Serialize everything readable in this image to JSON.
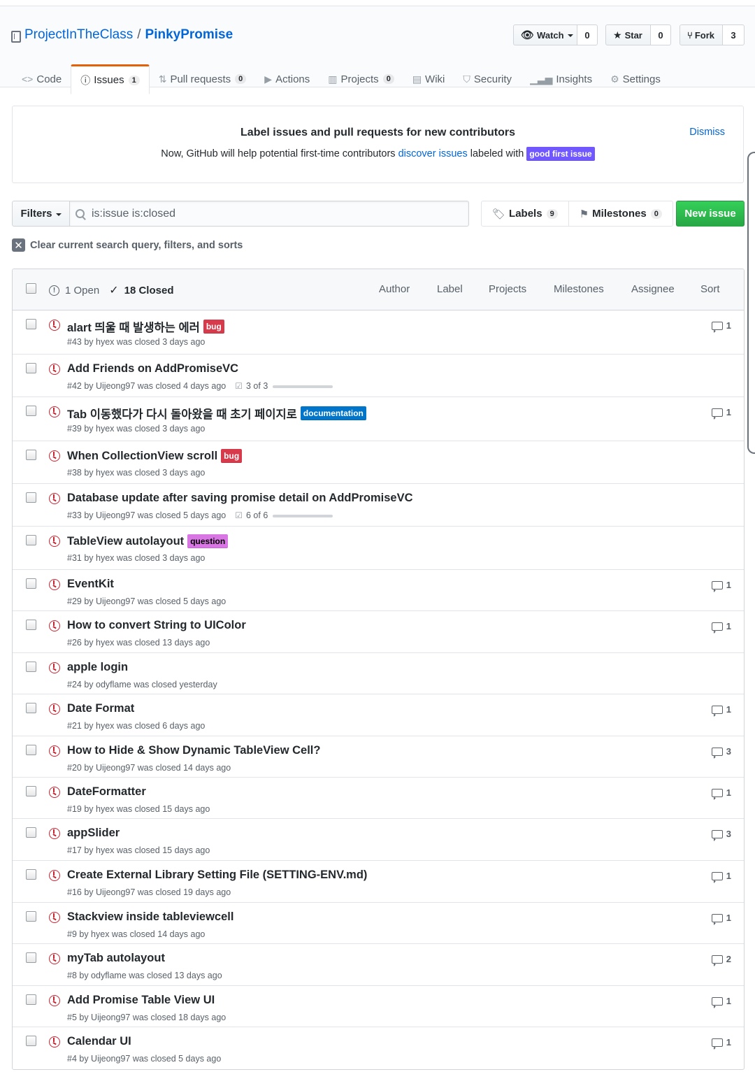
{
  "repo": {
    "owner": "ProjectInTheClass",
    "separator": "/",
    "name": "PinkyPromise"
  },
  "actions": {
    "watch": {
      "label": "Watch",
      "count": "0"
    },
    "star": {
      "label": "Star",
      "count": "0"
    },
    "fork": {
      "label": "Fork",
      "count": "3"
    }
  },
  "tabs": [
    {
      "label": "Code",
      "icon": "code-icon",
      "counter": ""
    },
    {
      "label": "Issues",
      "icon": "issue-opened-icon",
      "counter": "1"
    },
    {
      "label": "Pull requests",
      "icon": "git-pull-request-icon",
      "counter": "0"
    },
    {
      "label": "Actions",
      "icon": "play-icon",
      "counter": ""
    },
    {
      "label": "Projects",
      "icon": "project-icon",
      "counter": "0"
    },
    {
      "label": "Wiki",
      "icon": "book-icon",
      "counter": ""
    },
    {
      "label": "Security",
      "icon": "shield-icon",
      "counter": ""
    },
    {
      "label": "Insights",
      "icon": "graph-icon",
      "counter": ""
    },
    {
      "label": "Settings",
      "icon": "gear-icon",
      "counter": ""
    }
  ],
  "banner": {
    "title": "Label issues and pull requests for new contributors",
    "text_before": "Now, GitHub will help potential first-time contributors ",
    "link": "discover issues",
    "text_after": " labeled with ",
    "label": "good first issue",
    "label_color": "#7057ff",
    "dismiss": "Dismiss"
  },
  "toolbar": {
    "filters": "Filters",
    "search_value": "is:issue is:closed",
    "labels": "Labels",
    "labels_count": "9",
    "milestones": "Milestones",
    "milestones_count": "0",
    "new_issue": "New issue",
    "clear": "Clear current search query, filters, and sorts"
  },
  "list_header": {
    "open": "1 Open",
    "closed": "18 Closed",
    "sorts": [
      "Author",
      "Label",
      "Projects",
      "Milestones",
      "Assignee",
      "Sort"
    ]
  },
  "label_colors": {
    "bug": "#d73a4a",
    "documentation": "#0075ca",
    "question": "#d876e3"
  },
  "issues": [
    {
      "title": "alart 띄울 때 발생하는 에러",
      "label": "bug",
      "meta": "#43 by hyex was closed 3 days ago",
      "tasks": "",
      "comments": "1"
    },
    {
      "title": "Add Friends on AddPromiseVC",
      "label": "",
      "meta": "#42 by Uijeong97 was closed 4 days ago",
      "tasks": "3 of 3",
      "comments": ""
    },
    {
      "title": "Tab 이동했다가 다시 돌아왔을 때 초기 페이지로",
      "label": "documentation",
      "meta": "#39 by hyex was closed 3 days ago",
      "tasks": "",
      "comments": "1"
    },
    {
      "title": "When CollectionView scroll",
      "label": "bug",
      "meta": "#38 by hyex was closed 3 days ago",
      "tasks": "",
      "comments": ""
    },
    {
      "title": "Database update after saving promise detail on AddPromiseVC",
      "label": "",
      "meta": "#33 by Uijeong97 was closed 5 days ago",
      "tasks": "6 of 6",
      "comments": ""
    },
    {
      "title": "TableView autolayout",
      "label": "question",
      "meta": "#31 by hyex was closed 3 days ago",
      "tasks": "",
      "comments": ""
    },
    {
      "title": "EventKit",
      "label": "",
      "meta": "#29 by Uijeong97 was closed 5 days ago",
      "tasks": "",
      "comments": "1"
    },
    {
      "title": "How to convert String to UIColor",
      "label": "",
      "meta": "#26 by hyex was closed 13 days ago",
      "tasks": "",
      "comments": "1"
    },
    {
      "title": "apple login",
      "label": "",
      "meta": "#24 by odyflame was closed yesterday",
      "tasks": "",
      "comments": ""
    },
    {
      "title": "Date Format",
      "label": "",
      "meta": "#21 by hyex was closed 6 days ago",
      "tasks": "",
      "comments": "1"
    },
    {
      "title": "How to Hide & Show Dynamic TableView Cell?",
      "label": "",
      "meta": "#20 by Uijeong97 was closed 14 days ago",
      "tasks": "",
      "comments": "3"
    },
    {
      "title": "DateFormatter",
      "label": "",
      "meta": "#19 by hyex was closed 15 days ago",
      "tasks": "",
      "comments": "1"
    },
    {
      "title": "appSlider",
      "label": "",
      "meta": "#17 by hyex was closed 15 days ago",
      "tasks": "",
      "comments": "3"
    },
    {
      "title": "Create External Library Setting File (SETTING-ENV.md)",
      "label": "",
      "meta": "#16 by Uijeong97 was closed 19 days ago",
      "tasks": "",
      "comments": "1"
    },
    {
      "title": "Stackview inside tableviewcell",
      "label": "",
      "meta": "#9 by hyex was closed 14 days ago",
      "tasks": "",
      "comments": "1"
    },
    {
      "title": "myTab autolayout",
      "label": "",
      "meta": "#8 by odyflame was closed 13 days ago",
      "tasks": "",
      "comments": "2"
    },
    {
      "title": "Add Promise Table View UI",
      "label": "",
      "meta": "#5 by Uijeong97 was closed 18 days ago",
      "tasks": "",
      "comments": "1"
    },
    {
      "title": "Calendar UI",
      "label": "",
      "meta": "#4 by Uijeong97 was closed 5 days ago",
      "tasks": "",
      "comments": "1"
    }
  ]
}
